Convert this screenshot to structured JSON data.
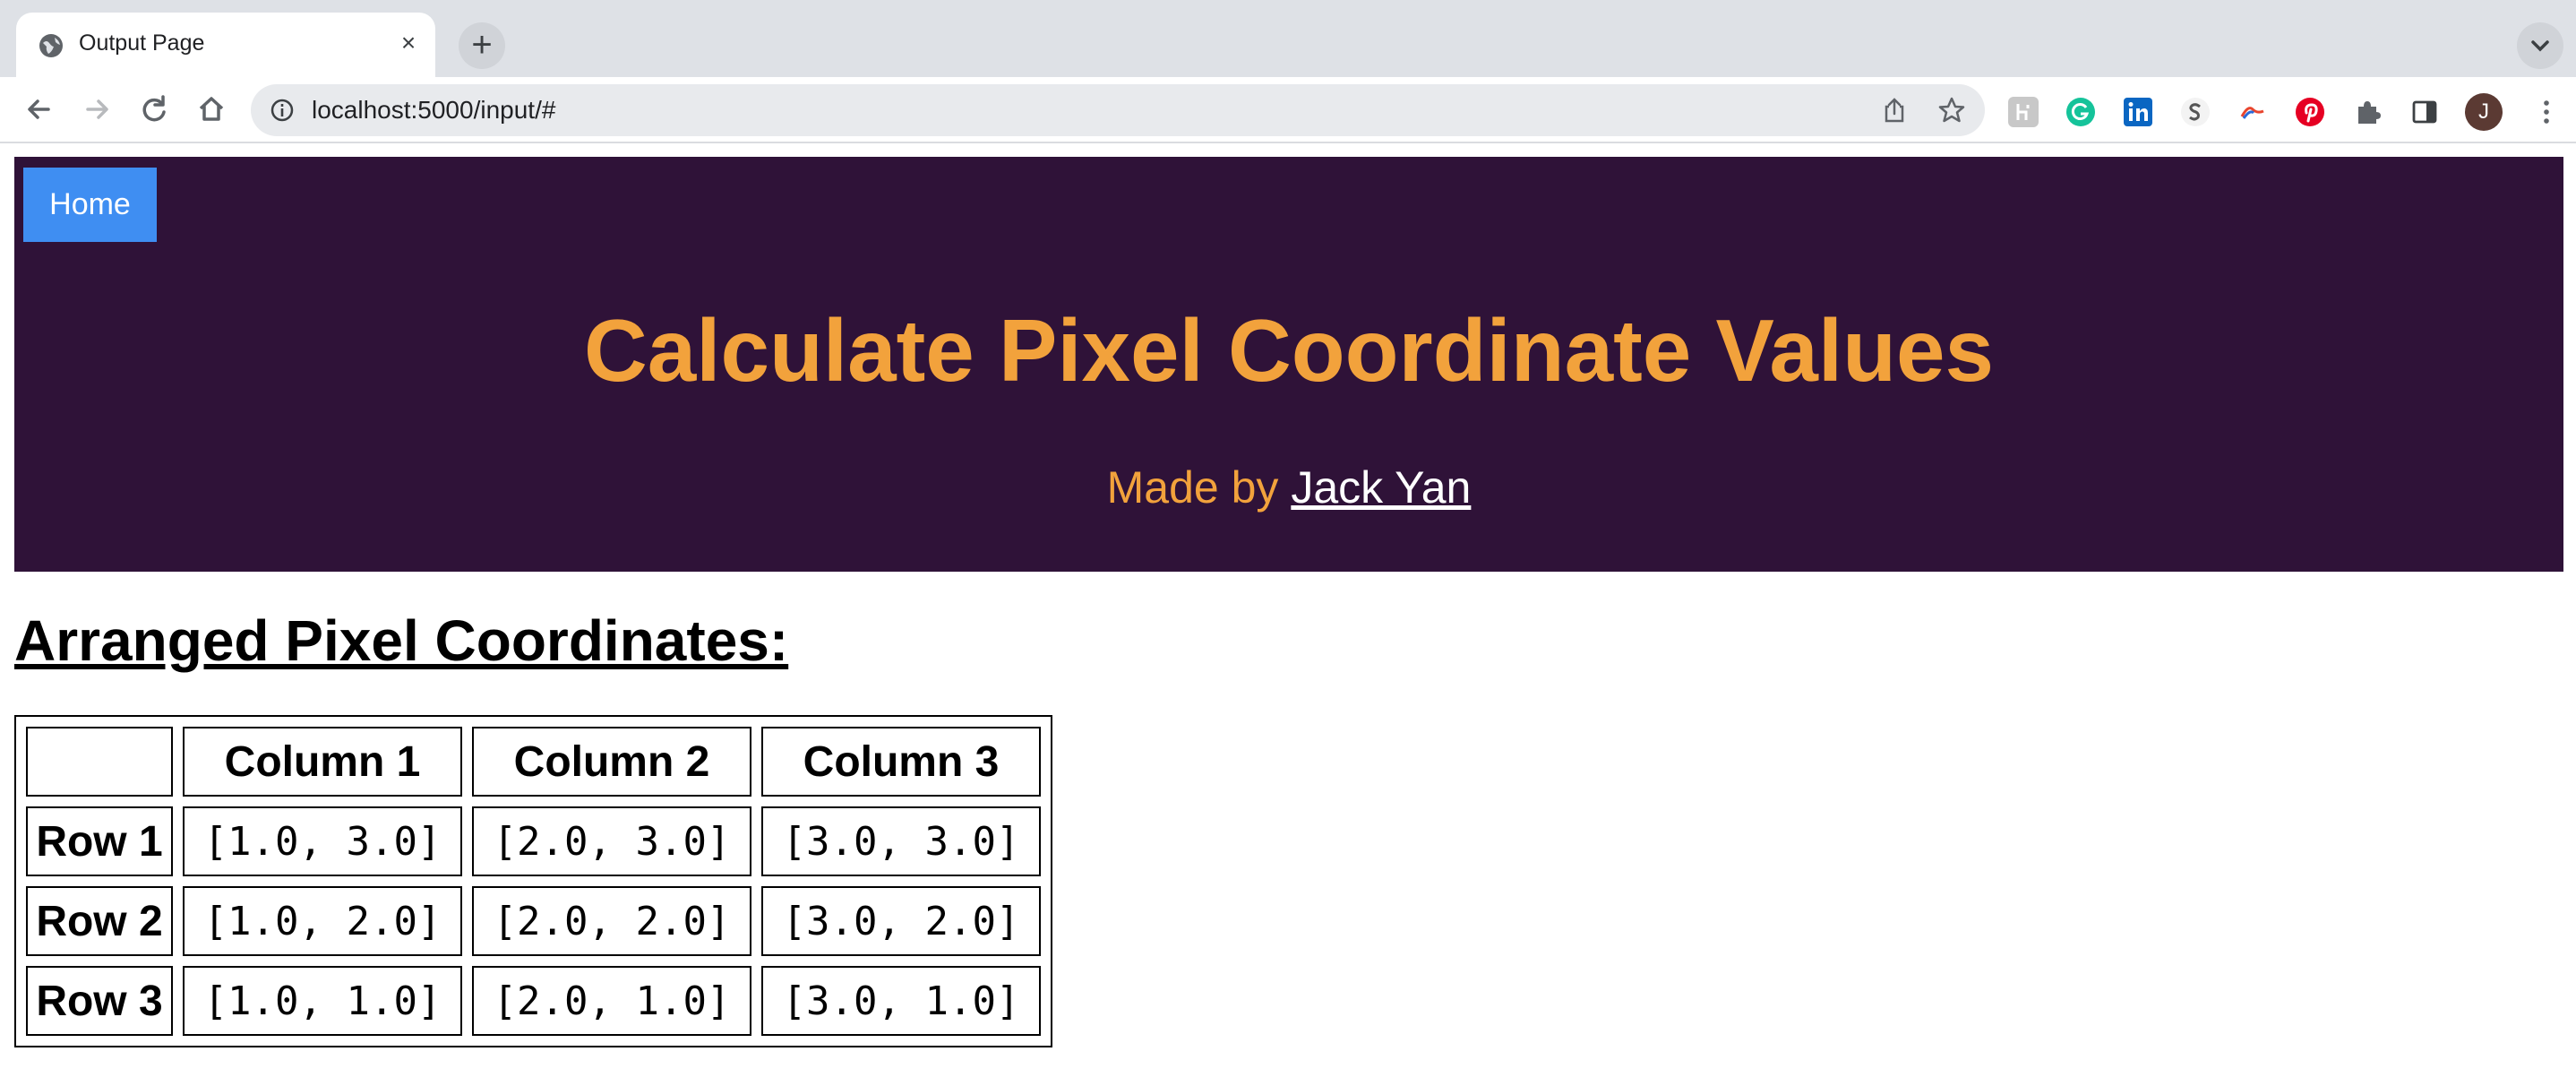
{
  "browser": {
    "tab_title": "Output Page",
    "tab_close": "×",
    "new_tab": "+",
    "url": "localhost:5000/input/#",
    "profile_initial": "J",
    "icons": [
      "back-icon",
      "forward-icon",
      "reload-icon",
      "home-icon",
      "site-info-icon",
      "share-icon",
      "star-icon",
      "extension-icon",
      "grammarly-icon",
      "linkedin-icon",
      "extension-s-icon",
      "extension-arc-icon",
      "pinterest-icon",
      "puzzle-icon",
      "sidepanel-icon",
      "avatar",
      "kebab-menu-icon"
    ]
  },
  "header": {
    "home_label": "Home",
    "title": "Calculate Pixel Coordinate Values",
    "made_by_prefix": "Made by",
    "author": "Jack Yan",
    "colors": {
      "background": "#2f1238",
      "title": "#f2a23c",
      "home_button": "#3f8ef2"
    }
  },
  "main": {
    "heading": "Arranged Pixel Coordinates:",
    "table": {
      "columns": [
        "Column 1",
        "Column 2",
        "Column 3"
      ],
      "rows": [
        {
          "label": "Row 1",
          "cells": [
            "[1.0, 3.0]",
            "[2.0, 3.0]",
            "[3.0, 3.0]"
          ]
        },
        {
          "label": "Row 2",
          "cells": [
            "[1.0, 2.0]",
            "[2.0, 2.0]",
            "[3.0, 2.0]"
          ]
        },
        {
          "label": "Row 3",
          "cells": [
            "[1.0, 1.0]",
            "[2.0, 1.0]",
            "[3.0, 1.0]"
          ]
        }
      ]
    }
  }
}
